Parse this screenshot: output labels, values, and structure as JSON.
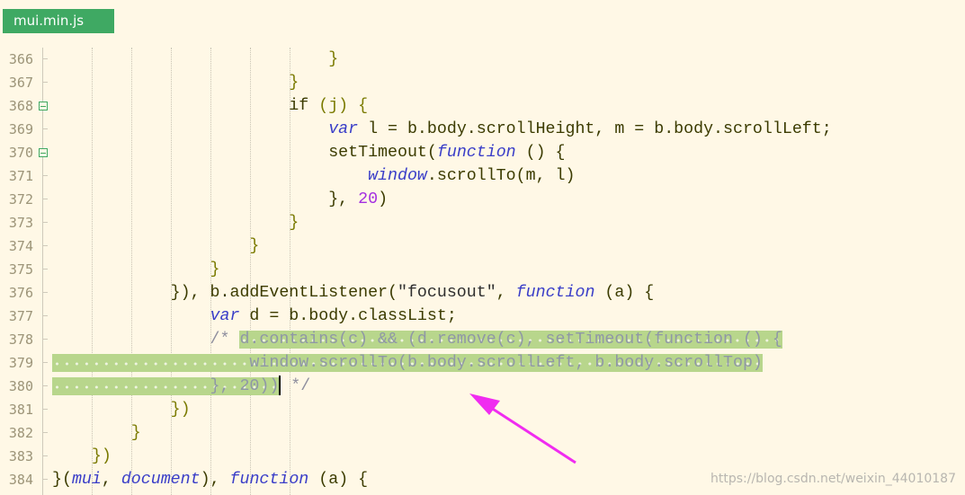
{
  "tab": {
    "title": "mui.min.js"
  },
  "watermark": "https://blog.csdn.net/weixin_44010187",
  "colors": {
    "tab": "#3fa963",
    "selection": "#b8d68c",
    "keyword": "#3a3ec8",
    "number": "#a42fe0",
    "comment": "#8e8e9e",
    "arrow": "#f02cf0"
  },
  "lines": [
    {
      "n": "366",
      "fold": false,
      "t": [
        [
          "                            ",
          ""
        ],
        [
          "}",
          "p"
        ]
      ]
    },
    {
      "n": "367",
      "fold": false,
      "t": [
        [
          "                        ",
          ""
        ],
        [
          "}",
          "p"
        ]
      ]
    },
    {
      "n": "368",
      "fold": true,
      "t": [
        [
          "                        ",
          ""
        ],
        [
          "if ",
          ""
        ],
        [
          "(j) {",
          "p"
        ]
      ]
    },
    {
      "n": "369",
      "fold": false,
      "t": [
        [
          "                            ",
          ""
        ],
        [
          "var",
          "k"
        ],
        [
          " l = b.body.scrollHeight, m = b.body.scrollLeft;",
          ""
        ]
      ]
    },
    {
      "n": "370",
      "fold": true,
      "t": [
        [
          "                            ",
          ""
        ],
        [
          "setTimeout(",
          ""
        ],
        [
          "function",
          "k"
        ],
        [
          " () {",
          ""
        ]
      ]
    },
    {
      "n": "371",
      "fold": false,
      "t": [
        [
          "                                ",
          ""
        ],
        [
          "window",
          "k"
        ],
        [
          ".scrollTo(m, l)",
          ""
        ]
      ]
    },
    {
      "n": "372",
      "fold": false,
      "t": [
        [
          "                            ",
          ""
        ],
        [
          "}, ",
          ""
        ],
        [
          "20",
          "n"
        ],
        [
          ")",
          ""
        ]
      ]
    },
    {
      "n": "373",
      "fold": false,
      "t": [
        [
          "                        ",
          ""
        ],
        [
          "}",
          "p"
        ]
      ]
    },
    {
      "n": "374",
      "fold": false,
      "t": [
        [
          "                    ",
          ""
        ],
        [
          "}",
          "p"
        ]
      ]
    },
    {
      "n": "375",
      "fold": false,
      "t": [
        [
          "                ",
          ""
        ],
        [
          "}",
          "p"
        ]
      ]
    },
    {
      "n": "376",
      "fold": false,
      "t": [
        [
          "            ",
          ""
        ],
        [
          "}), b.addEventListener(",
          ""
        ],
        [
          "\"focusout\"",
          "s"
        ],
        [
          ", ",
          ""
        ],
        [
          "function",
          "k"
        ],
        [
          " (a) {",
          ""
        ]
      ]
    },
    {
      "n": "377",
      "fold": false,
      "t": [
        [
          "                ",
          ""
        ],
        [
          "var",
          "k"
        ],
        [
          " d = b.body.classList;",
          ""
        ]
      ]
    },
    {
      "n": "378",
      "fold": false,
      "t": [
        [
          "                ",
          ""
        ],
        [
          "/* ",
          "c"
        ],
        [
          "d.contains(c) && (d.remove(c), setTimeout(function () {",
          "sel"
        ]
      ]
    },
    {
      "n": "379",
      "fold": false,
      "t": [
        [
          "                    window.scrollTo(b.body.scrollLeft, b.body.scrollTop)",
          "sel"
        ]
      ]
    },
    {
      "n": "380",
      "fold": false,
      "t": [
        [
          "                }, 20))",
          "sel"
        ],
        [
          "",
          "caret"
        ],
        [
          " */",
          "c"
        ]
      ]
    },
    {
      "n": "381",
      "fold": false,
      "t": [
        [
          "            ",
          ""
        ],
        [
          "})",
          "p"
        ]
      ]
    },
    {
      "n": "382",
      "fold": false,
      "t": [
        [
          "        ",
          ""
        ],
        [
          "}",
          "p"
        ]
      ]
    },
    {
      "n": "383",
      "fold": false,
      "t": [
        [
          "    ",
          ""
        ],
        [
          "})",
          "p"
        ]
      ]
    },
    {
      "n": "384",
      "fold": false,
      "t": [
        [
          "}(",
          ""
        ],
        [
          "mui",
          "k"
        ],
        [
          ", ",
          ""
        ],
        [
          "document",
          "k"
        ],
        [
          "), ",
          ""
        ],
        [
          "function",
          "k"
        ],
        [
          " (a) {",
          ""
        ]
      ]
    }
  ]
}
